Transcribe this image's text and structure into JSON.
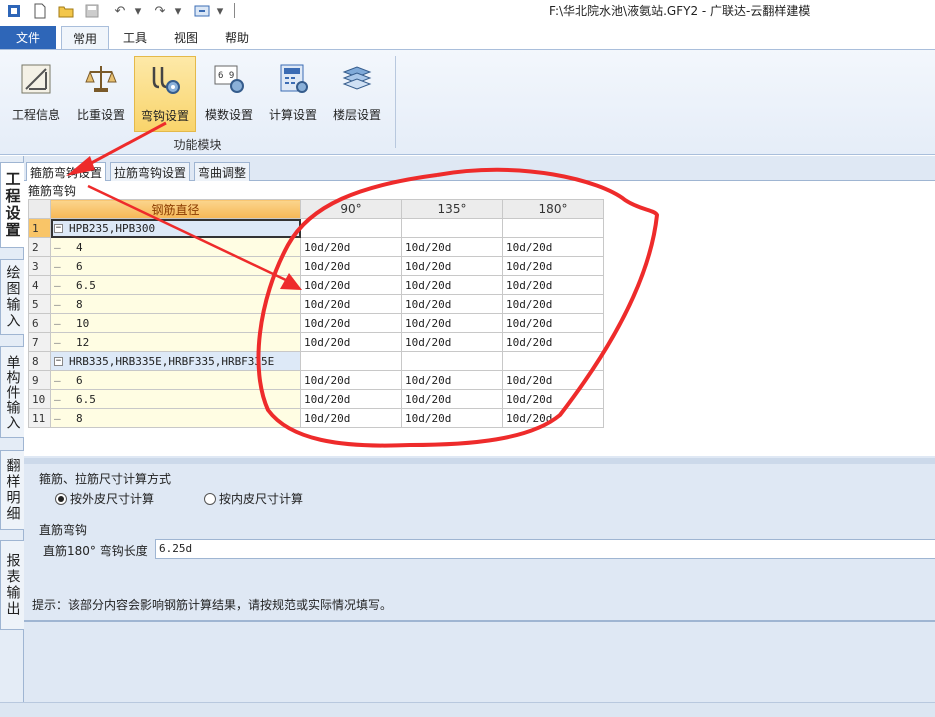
{
  "window": {
    "title": "F:\\华北院水池\\液氨站.GFY2 - 广联达-云翻样建模"
  },
  "ribbon_tabs": {
    "file": "文件",
    "common": "常用",
    "tools": "工具",
    "view": "视图",
    "help": "帮助"
  },
  "ribbon": {
    "buttons": [
      {
        "label": "工程信息",
        "icon": "project-info-icon"
      },
      {
        "label": "比重设置",
        "icon": "scale-icon"
      },
      {
        "label": "弯钩设置",
        "icon": "hook-settings-icon"
      },
      {
        "label": "模数设置",
        "icon": "modulus-icon"
      },
      {
        "label": "计算设置",
        "icon": "calculator-icon"
      },
      {
        "label": "楼层设置",
        "icon": "floors-icon"
      }
    ],
    "group_label": "功能模块"
  },
  "side_tabs": [
    "工程设置",
    "绘图输入",
    "单构件输入",
    "翻样明细",
    "报表输出"
  ],
  "sub_tabs": [
    "箍筋弯钩设置",
    "拉筋弯钩设置",
    "弯曲调整"
  ],
  "section_label": "箍筋弯钩",
  "grid": {
    "headers": [
      "钢筋直径",
      "90°",
      "135°",
      "180°"
    ],
    "rows": [
      {
        "num": "1",
        "label": "HPB235,HPB300",
        "group": true,
        "v90": "",
        "v135": "",
        "v180": ""
      },
      {
        "num": "2",
        "label": "4",
        "group": false,
        "v90": "10d/20d",
        "v135": "10d/20d",
        "v180": "10d/20d"
      },
      {
        "num": "3",
        "label": "6",
        "group": false,
        "v90": "10d/20d",
        "v135": "10d/20d",
        "v180": "10d/20d"
      },
      {
        "num": "4",
        "label": "6.5",
        "group": false,
        "v90": "10d/20d",
        "v135": "10d/20d",
        "v180": "10d/20d"
      },
      {
        "num": "5",
        "label": "8",
        "group": false,
        "v90": "10d/20d",
        "v135": "10d/20d",
        "v180": "10d/20d"
      },
      {
        "num": "6",
        "label": "10",
        "group": false,
        "v90": "10d/20d",
        "v135": "10d/20d",
        "v180": "10d/20d"
      },
      {
        "num": "7",
        "label": "12",
        "group": false,
        "v90": "10d/20d",
        "v135": "10d/20d",
        "v180": "10d/20d"
      },
      {
        "num": "8",
        "label": "HRB335,HRB335E,HRBF335,HRBF335E",
        "group": true,
        "v90": "",
        "v135": "",
        "v180": ""
      },
      {
        "num": "9",
        "label": "6",
        "group": false,
        "v90": "10d/20d",
        "v135": "10d/20d",
        "v180": "10d/20d"
      },
      {
        "num": "10",
        "label": "6.5",
        "group": false,
        "v90": "10d/20d",
        "v135": "10d/20d",
        "v180": "10d/20d"
      },
      {
        "num": "11",
        "label": "8",
        "group": false,
        "v90": "10d/20d",
        "v135": "10d/20d",
        "v180": "10d/20d"
      }
    ]
  },
  "settings": {
    "calc_title": "箍筋、拉筋尺寸计算方式",
    "radio_outer": "按外皮尺寸计算",
    "radio_inner": "按内皮尺寸计算",
    "straight_title": "直筋弯钩",
    "straight_label": "直筋180° 弯钩长度",
    "straight_value": "6.25d",
    "hint": "提示：该部分内容会影响钢筋计算结果，请按规范或实际情况填写。"
  },
  "colors": {
    "accent": "#2e66b8",
    "annotation": "#ee2b2b",
    "active_button": "#f9d46b"
  }
}
